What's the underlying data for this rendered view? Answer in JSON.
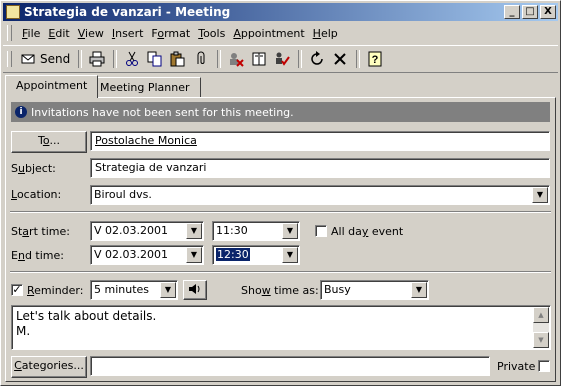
{
  "window": {
    "title": "Strategia de vanzari - Meeting",
    "minimize": "_",
    "maximize": "□",
    "close": "X"
  },
  "menu": [
    {
      "pre": "",
      "u": "F",
      "post": "ile"
    },
    {
      "pre": "",
      "u": "E",
      "post": "dit"
    },
    {
      "pre": "",
      "u": "V",
      "post": "iew"
    },
    {
      "pre": "",
      "u": "I",
      "post": "nsert"
    },
    {
      "pre": "F",
      "u": "o",
      "post": "rmat"
    },
    {
      "pre": "",
      "u": "T",
      "post": "ools"
    },
    {
      "pre": "",
      "u": "A",
      "post": "ppointment"
    },
    {
      "pre": "",
      "u": "H",
      "post": "elp"
    }
  ],
  "toolbar": {
    "send_label": "Send",
    "icons": [
      "send-icon",
      "print-icon",
      "cut-icon",
      "copy-icon",
      "paste-icon",
      "attach-icon",
      "cancel-invitation-icon",
      "address-book-icon",
      "check-names-icon",
      "recurrence-icon",
      "delete-icon",
      "help-icon"
    ]
  },
  "tabs": {
    "appointment": "Appointment",
    "planner": "Meeting Planner"
  },
  "info": {
    "text": "Invitations have not been sent for this meeting."
  },
  "to": {
    "button_pre": "T",
    "button_u": "o",
    "button_post": "...",
    "value": "Postolache Monica"
  },
  "subject": {
    "label_pre": "S",
    "label_u": "u",
    "label_post": "bject:",
    "value": "Strategia de vanzari"
  },
  "location": {
    "label_pre": "",
    "label_u": "L",
    "label_post": "ocation:",
    "value": "Biroul dvs."
  },
  "start": {
    "label_pre": "St",
    "label_u": "a",
    "label_post": "rt time:",
    "date": "V 02.03.2001",
    "time": "11:30"
  },
  "end": {
    "label_pre": "E",
    "label_u": "n",
    "label_post": "d time:",
    "date": "V 02.03.2001",
    "time": "12:30"
  },
  "allday": {
    "label_pre": "All da",
    "label_u": "y",
    "label_post": " event",
    "checked": false
  },
  "reminder": {
    "label_pre": "",
    "label_u": "R",
    "label_post": "eminder:",
    "checked": true,
    "value": "5 minutes"
  },
  "showtime": {
    "label_pre": "Sho",
    "label_u": "w",
    "label_post": " time as:",
    "value": "Busy"
  },
  "notes": {
    "line1": "Let's talk about details.",
    "line2": "M."
  },
  "categories": {
    "button_pre": "",
    "button_u": "C",
    "button_post": "ategories...",
    "value": ""
  },
  "private": {
    "label": "Private",
    "checked": false
  }
}
